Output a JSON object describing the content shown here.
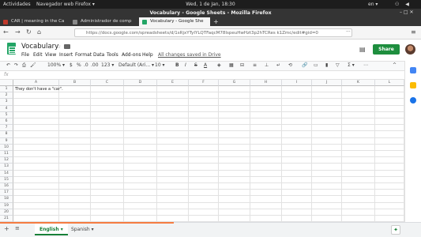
{
  "system": {
    "activities": "Actividades",
    "app_name": "Navegador web Firefox ▾",
    "clock": "Wed,  1 de Jan, 18:30",
    "lang": "en ▾",
    "sys_icons": "⚇ ◀ ⏻ ▾"
  },
  "window": {
    "title": "Vocabulary - Google Sheets - Mozilla Firefox",
    "controls": "– □ ✕"
  },
  "tabs": [
    {
      "label": "CAR | meaning in the Ca",
      "icon_color": "#c0392b"
    },
    {
      "label": "Administrador de comp",
      "icon_color": "#888888"
    },
    {
      "label": "Vocabulary - Google She",
      "icon_color": "#23a566"
    }
  ],
  "new_tab": "+",
  "nav": {
    "back": "←",
    "forward": "→",
    "reload": "↻",
    "home": "⌂",
    "url": "https://docs.google.com/spreadsheets/d/1sRjxYTyIYLQTFaqcM78IspeuHwHzt3p2hTCRes k1Zmc/edit#gid=0",
    "dots": "···",
    "menu_icon": "≡"
  },
  "doc": {
    "title": "Vocabulary",
    "menus": [
      "File",
      "Edit",
      "View",
      "Insert",
      "Format",
      "Data",
      "Tools",
      "Add-ons",
      "Help"
    ],
    "saved": "All changes saved in Drive",
    "share": "Share"
  },
  "toolbar": {
    "undo": "↶",
    "redo": "↷",
    "print": "⎙",
    "paint": "🖌",
    "zoom": "100%  ▾",
    "currency": "$",
    "percent": "%",
    "dec0": ".0",
    "dec00": ".00",
    "more_formats": "123 ▾",
    "font": "Default (Ari... ▾",
    "size": "10  ▾",
    "bold": "B",
    "italic": "I",
    "strike": "S",
    "color": "A",
    "more": "⋯",
    "sigma": "Σ ▾",
    "collapse": "^"
  },
  "formula": {
    "fx": "fx"
  },
  "grid": {
    "columns": [
      "A",
      "B",
      "C",
      "D",
      "E",
      "F",
      "G",
      "H",
      "I",
      "J",
      "K",
      "L"
    ],
    "rows": [
      "1",
      "2",
      "3",
      "4",
      "5",
      "6",
      "7",
      "8",
      "9",
      "10",
      "11",
      "12",
      "13",
      "14",
      "15",
      "16",
      "17",
      "18",
      "19",
      "20",
      "21"
    ],
    "a1": "They don't have a \"car\"."
  },
  "sheets": {
    "add": "+",
    "all": "≡",
    "tabs": [
      {
        "label": "English  ▾"
      },
      {
        "label": "Spanish  ▾"
      }
    ],
    "explore": "✦"
  }
}
